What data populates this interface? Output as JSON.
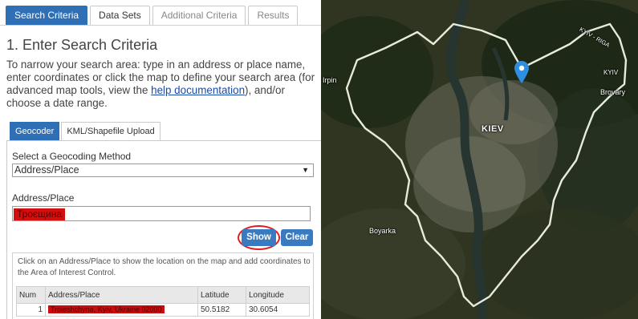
{
  "tabs": [
    {
      "label": "Search Criteria",
      "active": true
    },
    {
      "label": "Data Sets",
      "active": false
    },
    {
      "label": "Additional Criteria",
      "active": false
    },
    {
      "label": "Results",
      "active": false
    }
  ],
  "heading": "1. Enter Search Criteria",
  "intro": {
    "before": "To narrow your search area: type in an address or place name, enter coordinates or click the map to define your search area (for advanced map tools, view the ",
    "link": "help documentation",
    "after": "), and/or choose a date range."
  },
  "subtabs": [
    {
      "label": "Geocoder",
      "active": true
    },
    {
      "label": "KML/Shapefile Upload",
      "active": false
    }
  ],
  "geocoder": {
    "method_label": "Select a Geocoding Method",
    "method_value": "Address/Place",
    "address_label": "Address/Place",
    "address_value": "Троєщина",
    "show_label": "Show",
    "clear_label": "Clear",
    "results_note": "Click on an Address/Place to show the location on the map and add coordinates to the Area of Interest Control.",
    "columns": [
      "Num",
      "Address/Place",
      "Latitude",
      "Longitude"
    ],
    "rows": [
      {
        "num": "1",
        "place": "Troieshchyna, Kyiv, Ukraine 02000",
        "lat": "50.5182",
        "lon": "30.6054"
      }
    ]
  },
  "map": {
    "city_label": "KIEV",
    "labels": [
      "Irpin",
      "Boyarka",
      "Brovary",
      "KYIV",
      "KYIV - RIGA"
    ],
    "colors": {
      "boundary": "#e8eadc",
      "river": "#26352f",
      "pin": "#2e8fe0",
      "accent": "#2f6fb6"
    }
  }
}
